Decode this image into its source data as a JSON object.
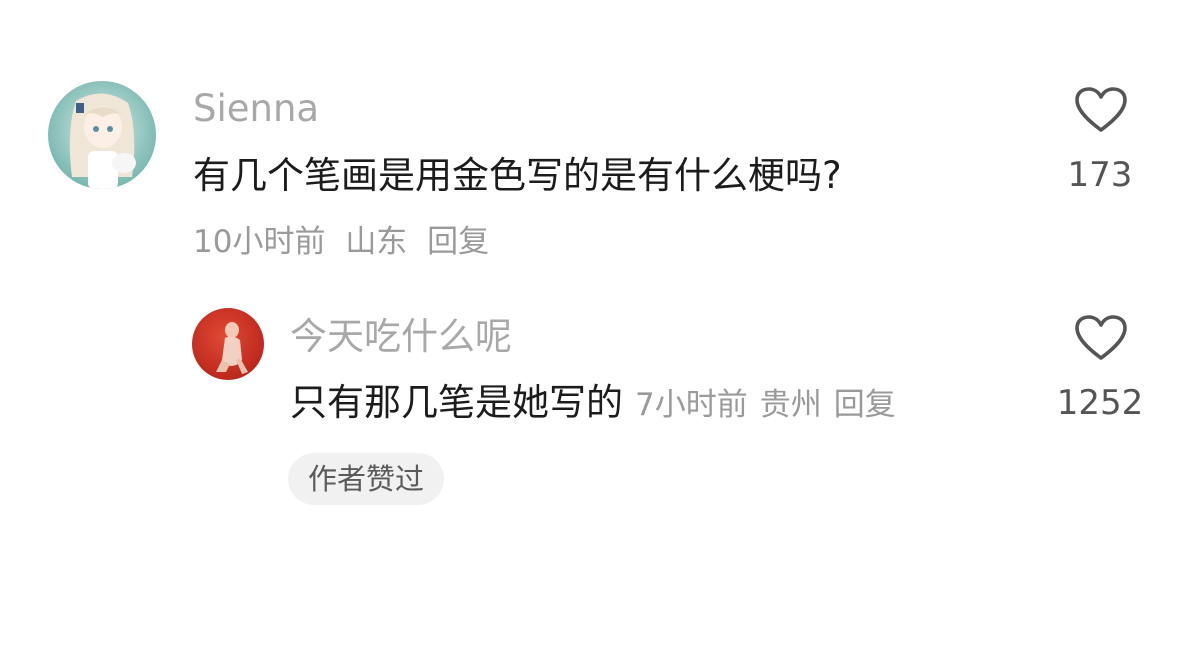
{
  "comment": {
    "username": "Sienna",
    "text": "有几个笔画是用金色写的是有什么梗吗?",
    "time": "10小时前",
    "location": "山东",
    "reply_label": "回复",
    "like_count": "173",
    "like_icon": "heart-outline-icon"
  },
  "reply": {
    "username": "今天吃什么呢",
    "text": "只有那几笔是她写的",
    "time": "7小时前",
    "location": "贵州",
    "reply_label": "回复",
    "like_count": "1252",
    "like_icon": "heart-outline-icon",
    "badge": "作者赞过"
  },
  "colors": {
    "username": "#a8a8a8",
    "text": "#1c1c1c",
    "meta": "#9a9a9a",
    "badge_bg": "#f1f1f1"
  }
}
